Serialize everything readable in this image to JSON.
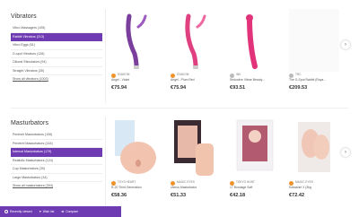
{
  "vibrators": {
    "title": "Vibrators",
    "items": [
      {
        "label": "Vibro Massagers (105)"
      },
      {
        "label": "Rabbit Vibrators (213)"
      },
      {
        "label": "Vibro Eggs (51)"
      },
      {
        "label": "G-spot Vibrators (126)"
      },
      {
        "label": "Clitoral Stimulators (94)"
      },
      {
        "label": "Straight Vibrators (35)"
      },
      {
        "label": "Show all vibrators (1003)"
      }
    ],
    "products": [
      {
        "brand": "SVAKOM",
        "name": "Angel - Violet",
        "price": "€75.94"
      },
      {
        "brand": "SVAKOM",
        "name": "Angel - Plum Red",
        "price": "€75.94"
      },
      {
        "brand": "INK",
        "name": "Seductive Vibrar Beauty...",
        "price": "€93.51"
      },
      {
        "brand": "TRC",
        "name": "The G-Spot Rabbit (Roya...",
        "price": "€209.53"
      }
    ]
  },
  "masturbators": {
    "title": "Masturbators",
    "items": [
      {
        "label": "Penilnet Masturbators (106)"
      },
      {
        "label": "Penetrel Masturbators (144)"
      },
      {
        "label": "Internal Masturbators (179)"
      },
      {
        "label": "Realistic Masturbators (124)"
      },
      {
        "label": "Cup Masturbators (39)"
      },
      {
        "label": "Large Masturbators (34)"
      },
      {
        "label": "Show all masturbators (394)"
      }
    ],
    "products": [
      {
        "brand": "Toys Heart",
        "name": "R-20 Third Generation",
        "price": "€58.36"
      },
      {
        "brand": "Magic Eyes",
        "name": "Uterus Masturbator",
        "price": "€51.33"
      },
      {
        "brand": "Tokyo Hunt",
        "name": "17 Bondage Soft",
        "price": "€42.18"
      },
      {
        "brand": "Magic Eyes",
        "name": "Kobashiri X (3kg",
        "price": "€72.42"
      }
    ]
  },
  "bottom_bar": {
    "recent": "Recently viewed",
    "wishlist": "Wish list",
    "compare": "Compare"
  },
  "colors": {
    "accent": "#6e3bb3",
    "brand_badge": "#f0922c"
  }
}
